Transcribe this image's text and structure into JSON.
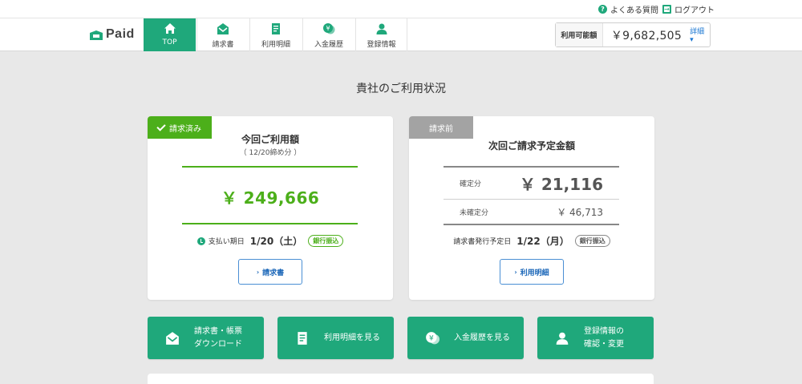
{
  "utility": {
    "faq_label": "よくある質問",
    "logout_label": "ログアウト"
  },
  "brand": {
    "logo_text": "Paid",
    "accent": "#1fa87b"
  },
  "nav": {
    "tabs": [
      {
        "label": "TOP",
        "icon": "home-icon",
        "active": true
      },
      {
        "label": "請求書",
        "icon": "mail-icon",
        "active": false
      },
      {
        "label": "利用明細",
        "icon": "document-icon",
        "active": false
      },
      {
        "label": "入金履歴",
        "icon": "yen-coins-icon",
        "active": false
      },
      {
        "label": "登録情報",
        "icon": "user-icon",
        "active": false
      }
    ]
  },
  "balance": {
    "label": "利用可能額",
    "value": "￥9,682,505",
    "details_label": "詳細 ▾"
  },
  "page_title": "貴社のご利用状況",
  "current_card": {
    "badge": "請求済み",
    "title": "今回ご利用額",
    "subtitle": "（ 12/20締め分 ）",
    "amount": "￥ 249,666",
    "due_label": "支払い期日",
    "due_date": "1/20（土）",
    "method": "銀行振込",
    "button_label": "請求書",
    "colors": {
      "badge": "#4caf1a",
      "amount": "#4caf1a"
    }
  },
  "next_card": {
    "badge": "請求前",
    "title": "次回ご請求予定金額",
    "confirmed_label": "確定分",
    "confirmed_amount": "￥ 21,116",
    "unconfirmed_label": "未確定分",
    "unconfirmed_amount": "￥ 46,713",
    "issue_label": "請求書発行予定日",
    "issue_date": "1/22（月）",
    "method": "銀行振込",
    "button_label": "利用明細"
  },
  "actions": [
    {
      "line1": "請求書・帳票",
      "line2": "ダウンロード",
      "icon": "mail-icon"
    },
    {
      "line1": "利用明細を見る",
      "line2": "",
      "icon": "document-icon"
    },
    {
      "line1": "入金履歴を見る",
      "line2": "",
      "icon": "yen-coins-icon"
    },
    {
      "line1": "登録情報の",
      "line2": "確認・変更",
      "icon": "user-icon"
    }
  ]
}
